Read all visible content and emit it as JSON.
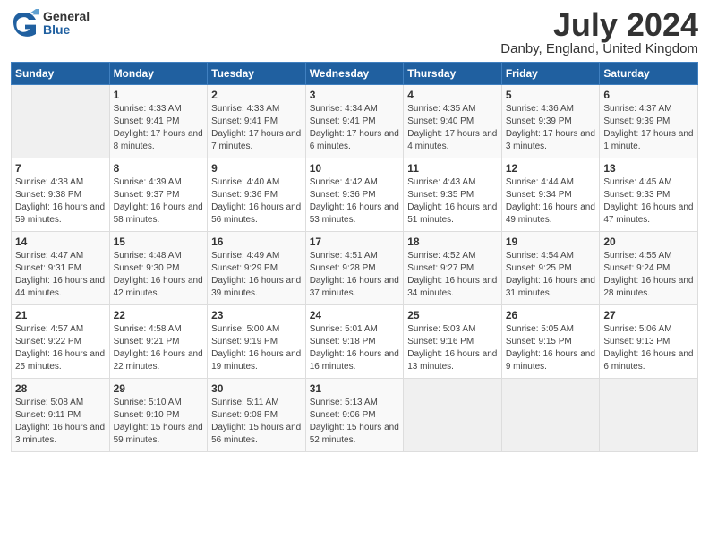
{
  "logo": {
    "general": "General",
    "blue": "Blue"
  },
  "title": "July 2024",
  "location": "Danby, England, United Kingdom",
  "days_of_week": [
    "Sunday",
    "Monday",
    "Tuesday",
    "Wednesday",
    "Thursday",
    "Friday",
    "Saturday"
  ],
  "weeks": [
    [
      {
        "num": "",
        "sunrise": "",
        "sunset": "",
        "daylight": "",
        "empty": true
      },
      {
        "num": "1",
        "sunrise": "Sunrise: 4:33 AM",
        "sunset": "Sunset: 9:41 PM",
        "daylight": "Daylight: 17 hours and 8 minutes."
      },
      {
        "num": "2",
        "sunrise": "Sunrise: 4:33 AM",
        "sunset": "Sunset: 9:41 PM",
        "daylight": "Daylight: 17 hours and 7 minutes."
      },
      {
        "num": "3",
        "sunrise": "Sunrise: 4:34 AM",
        "sunset": "Sunset: 9:41 PM",
        "daylight": "Daylight: 17 hours and 6 minutes."
      },
      {
        "num": "4",
        "sunrise": "Sunrise: 4:35 AM",
        "sunset": "Sunset: 9:40 PM",
        "daylight": "Daylight: 17 hours and 4 minutes."
      },
      {
        "num": "5",
        "sunrise": "Sunrise: 4:36 AM",
        "sunset": "Sunset: 9:39 PM",
        "daylight": "Daylight: 17 hours and 3 minutes."
      },
      {
        "num": "6",
        "sunrise": "Sunrise: 4:37 AM",
        "sunset": "Sunset: 9:39 PM",
        "daylight": "Daylight: 17 hours and 1 minute."
      }
    ],
    [
      {
        "num": "7",
        "sunrise": "Sunrise: 4:38 AM",
        "sunset": "Sunset: 9:38 PM",
        "daylight": "Daylight: 16 hours and 59 minutes."
      },
      {
        "num": "8",
        "sunrise": "Sunrise: 4:39 AM",
        "sunset": "Sunset: 9:37 PM",
        "daylight": "Daylight: 16 hours and 58 minutes."
      },
      {
        "num": "9",
        "sunrise": "Sunrise: 4:40 AM",
        "sunset": "Sunset: 9:36 PM",
        "daylight": "Daylight: 16 hours and 56 minutes."
      },
      {
        "num": "10",
        "sunrise": "Sunrise: 4:42 AM",
        "sunset": "Sunset: 9:36 PM",
        "daylight": "Daylight: 16 hours and 53 minutes."
      },
      {
        "num": "11",
        "sunrise": "Sunrise: 4:43 AM",
        "sunset": "Sunset: 9:35 PM",
        "daylight": "Daylight: 16 hours and 51 minutes."
      },
      {
        "num": "12",
        "sunrise": "Sunrise: 4:44 AM",
        "sunset": "Sunset: 9:34 PM",
        "daylight": "Daylight: 16 hours and 49 minutes."
      },
      {
        "num": "13",
        "sunrise": "Sunrise: 4:45 AM",
        "sunset": "Sunset: 9:33 PM",
        "daylight": "Daylight: 16 hours and 47 minutes."
      }
    ],
    [
      {
        "num": "14",
        "sunrise": "Sunrise: 4:47 AM",
        "sunset": "Sunset: 9:31 PM",
        "daylight": "Daylight: 16 hours and 44 minutes."
      },
      {
        "num": "15",
        "sunrise": "Sunrise: 4:48 AM",
        "sunset": "Sunset: 9:30 PM",
        "daylight": "Daylight: 16 hours and 42 minutes."
      },
      {
        "num": "16",
        "sunrise": "Sunrise: 4:49 AM",
        "sunset": "Sunset: 9:29 PM",
        "daylight": "Daylight: 16 hours and 39 minutes."
      },
      {
        "num": "17",
        "sunrise": "Sunrise: 4:51 AM",
        "sunset": "Sunset: 9:28 PM",
        "daylight": "Daylight: 16 hours and 37 minutes."
      },
      {
        "num": "18",
        "sunrise": "Sunrise: 4:52 AM",
        "sunset": "Sunset: 9:27 PM",
        "daylight": "Daylight: 16 hours and 34 minutes."
      },
      {
        "num": "19",
        "sunrise": "Sunrise: 4:54 AM",
        "sunset": "Sunset: 9:25 PM",
        "daylight": "Daylight: 16 hours and 31 minutes."
      },
      {
        "num": "20",
        "sunrise": "Sunrise: 4:55 AM",
        "sunset": "Sunset: 9:24 PM",
        "daylight": "Daylight: 16 hours and 28 minutes."
      }
    ],
    [
      {
        "num": "21",
        "sunrise": "Sunrise: 4:57 AM",
        "sunset": "Sunset: 9:22 PM",
        "daylight": "Daylight: 16 hours and 25 minutes."
      },
      {
        "num": "22",
        "sunrise": "Sunrise: 4:58 AM",
        "sunset": "Sunset: 9:21 PM",
        "daylight": "Daylight: 16 hours and 22 minutes."
      },
      {
        "num": "23",
        "sunrise": "Sunrise: 5:00 AM",
        "sunset": "Sunset: 9:19 PM",
        "daylight": "Daylight: 16 hours and 19 minutes."
      },
      {
        "num": "24",
        "sunrise": "Sunrise: 5:01 AM",
        "sunset": "Sunset: 9:18 PM",
        "daylight": "Daylight: 16 hours and 16 minutes."
      },
      {
        "num": "25",
        "sunrise": "Sunrise: 5:03 AM",
        "sunset": "Sunset: 9:16 PM",
        "daylight": "Daylight: 16 hours and 13 minutes."
      },
      {
        "num": "26",
        "sunrise": "Sunrise: 5:05 AM",
        "sunset": "Sunset: 9:15 PM",
        "daylight": "Daylight: 16 hours and 9 minutes."
      },
      {
        "num": "27",
        "sunrise": "Sunrise: 5:06 AM",
        "sunset": "Sunset: 9:13 PM",
        "daylight": "Daylight: 16 hours and 6 minutes."
      }
    ],
    [
      {
        "num": "28",
        "sunrise": "Sunrise: 5:08 AM",
        "sunset": "Sunset: 9:11 PM",
        "daylight": "Daylight: 16 hours and 3 minutes."
      },
      {
        "num": "29",
        "sunrise": "Sunrise: 5:10 AM",
        "sunset": "Sunset: 9:10 PM",
        "daylight": "Daylight: 15 hours and 59 minutes."
      },
      {
        "num": "30",
        "sunrise": "Sunrise: 5:11 AM",
        "sunset": "Sunset: 9:08 PM",
        "daylight": "Daylight: 15 hours and 56 minutes."
      },
      {
        "num": "31",
        "sunrise": "Sunrise: 5:13 AM",
        "sunset": "Sunset: 9:06 PM",
        "daylight": "Daylight: 15 hours and 52 minutes."
      },
      {
        "num": "",
        "sunrise": "",
        "sunset": "",
        "daylight": "",
        "empty": true
      },
      {
        "num": "",
        "sunrise": "",
        "sunset": "",
        "daylight": "",
        "empty": true
      },
      {
        "num": "",
        "sunrise": "",
        "sunset": "",
        "daylight": "",
        "empty": true
      }
    ]
  ]
}
